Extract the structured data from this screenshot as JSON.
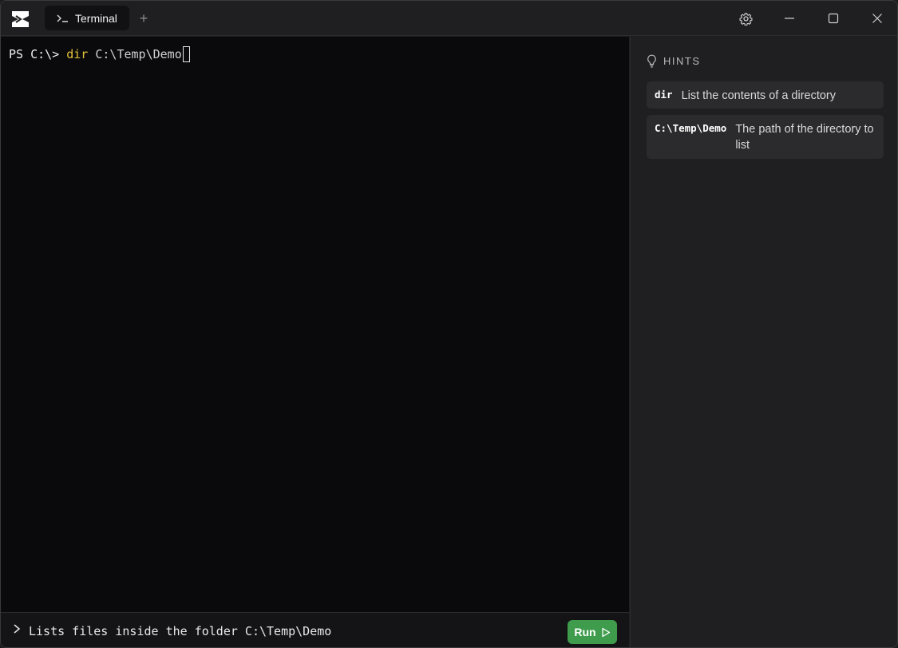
{
  "titlebar": {
    "tab_label": "Terminal",
    "new_tab_label": "+"
  },
  "terminal": {
    "prompt": "PS C:\\> ",
    "command": "dir",
    "argument": " C:\\Temp\\Demo"
  },
  "suggestion": {
    "text": "Lists files inside the folder C:\\Temp\\Demo",
    "run_label": "Run"
  },
  "hints": {
    "title": "HINTS",
    "items": [
      {
        "key": "dir",
        "description": "List the contents of a directory"
      },
      {
        "key": "C:\\Temp\\Demo",
        "description": "The path of the directory to list"
      }
    ]
  },
  "colors": {
    "command": "#e3c23a",
    "run_button": "#3f9c4d",
    "terminal_bg": "#0a0a0c",
    "panel_bg": "#1f1f21"
  },
  "icons": {
    "logo": "app-logo-icon",
    "tab": "terminal-prompt-icon",
    "settings": "gear-icon",
    "minimize": "minimize-icon",
    "maximize": "maximize-icon",
    "close": "close-icon",
    "hints": "lightbulb-icon",
    "suggest": "chevron-right-icon",
    "run": "play-icon"
  }
}
